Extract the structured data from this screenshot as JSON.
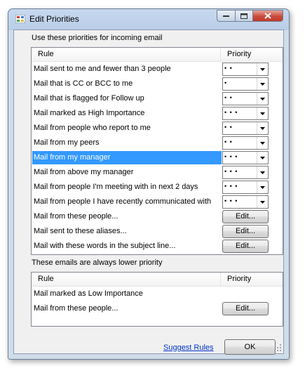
{
  "window": {
    "title": "Edit Priorities"
  },
  "incoming": {
    "section_label": "Use these priorities for incoming email",
    "header": {
      "rule": "Rule",
      "priority": "Priority"
    },
    "rows": [
      {
        "rule": "Mail sent to me and fewer than 3 people",
        "kind": "combo",
        "value": "• •"
      },
      {
        "rule": "Mail that is CC or BCC to me",
        "kind": "combo",
        "value": "•"
      },
      {
        "rule": "Mail that is flagged for Follow up",
        "kind": "combo",
        "value": "• •"
      },
      {
        "rule": "Mail marked as High Importance",
        "kind": "combo",
        "value": "• • •"
      },
      {
        "rule": "Mail from people who report to me",
        "kind": "combo",
        "value": "• •"
      },
      {
        "rule": "Mail from my peers",
        "kind": "combo",
        "value": "• •"
      },
      {
        "rule": "Mail from my manager",
        "kind": "combo",
        "value": "• • •",
        "selected": true
      },
      {
        "rule": "Mail from above my manager",
        "kind": "combo",
        "value": "• • •"
      },
      {
        "rule": "Mail from people I'm meeting with in next 2 days",
        "kind": "combo",
        "value": "• • •"
      },
      {
        "rule": "Mail from people I have recently communicated with",
        "kind": "combo",
        "value": "• • •"
      },
      {
        "rule": "Mail from these people...",
        "kind": "button",
        "value": "Edit..."
      },
      {
        "rule": "Mail sent to these aliases...",
        "kind": "button",
        "value": "Edit..."
      },
      {
        "rule": "Mail with these words in the subject line...",
        "kind": "button",
        "value": "Edit..."
      }
    ]
  },
  "lower": {
    "section_label": "These emails are always lower priority",
    "header": {
      "rule": "Rule",
      "priority": "Priority"
    },
    "rows": [
      {
        "rule": "Mail marked as Low Importance",
        "kind": "none",
        "value": ""
      },
      {
        "rule": "Mail from these people...",
        "kind": "button",
        "value": "Edit..."
      }
    ]
  },
  "footer": {
    "suggest_link": "Suggest Rules",
    "ok_label": "OK"
  },
  "colors": {
    "selection": "#3399ff",
    "link": "#0033cc",
    "close_button": "#c94b3c"
  },
  "icons": {
    "combo_arrow": "arrow-down-icon",
    "app": "app-icon"
  }
}
